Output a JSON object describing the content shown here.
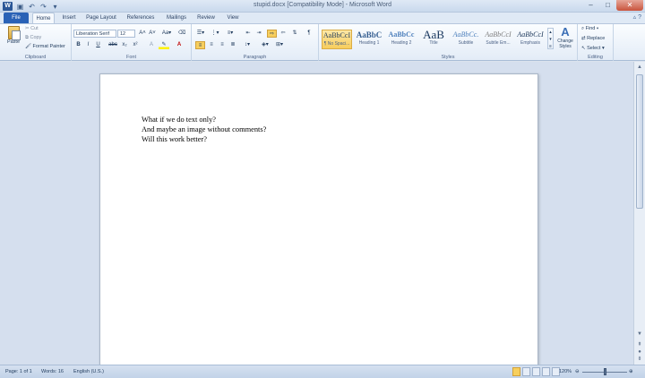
{
  "window": {
    "title": "stupid.docx [Compatibility Mode] - Microsoft Word",
    "controls": [
      "minimize-icon",
      "maximize-icon",
      "close-icon"
    ]
  },
  "quick_access": [
    "word-logo-icon",
    "save-icon",
    "undo-icon",
    "redo-icon",
    "customize-qat-icon"
  ],
  "tabs": [
    "File",
    "Home",
    "Insert",
    "Page Layout",
    "References",
    "Mailings",
    "Review",
    "View"
  ],
  "ribbon": {
    "clipboard": {
      "label": "Clipboard",
      "paste": "Paste",
      "cut": "Cut",
      "copy": "Copy",
      "format_painter": "Format Painter"
    },
    "font": {
      "label": "Font",
      "name": "Liberation Serif",
      "size": "12",
      "buttons": [
        "B",
        "I",
        "U",
        "abc",
        "x₂",
        "x²"
      ]
    },
    "paragraph": {
      "label": "Paragraph"
    },
    "styles": {
      "label": "Styles",
      "items": [
        {
          "preview": "AaBbCcI",
          "name": "¶ No Spaci..."
        },
        {
          "preview": "AaBbC",
          "name": "Heading 1"
        },
        {
          "preview": "AaBbCc",
          "name": "Heading 2"
        },
        {
          "preview": "AaB",
          "name": "Title"
        },
        {
          "preview": "AaBbCc.",
          "name": "Subtitle"
        },
        {
          "preview": "AaBbCcI",
          "name": "Subtle Em..."
        },
        {
          "preview": "AaBbCcI",
          "name": "Emphasis"
        }
      ],
      "change_styles": "Change Styles"
    },
    "editing": {
      "label": "Editing",
      "find": "Find",
      "replace": "Replace",
      "select": "Select"
    }
  },
  "document": {
    "lines": [
      "What if we do text only?",
      "And maybe an image without comments?",
      "Will this work better?"
    ]
  },
  "status": {
    "page": "Page: 1 of 1",
    "words": "Words: 16",
    "language": "English (U.S.)",
    "zoom": "120%"
  },
  "colors": {
    "accent": "#2a62b6",
    "highlight": "#f7cf5e"
  }
}
